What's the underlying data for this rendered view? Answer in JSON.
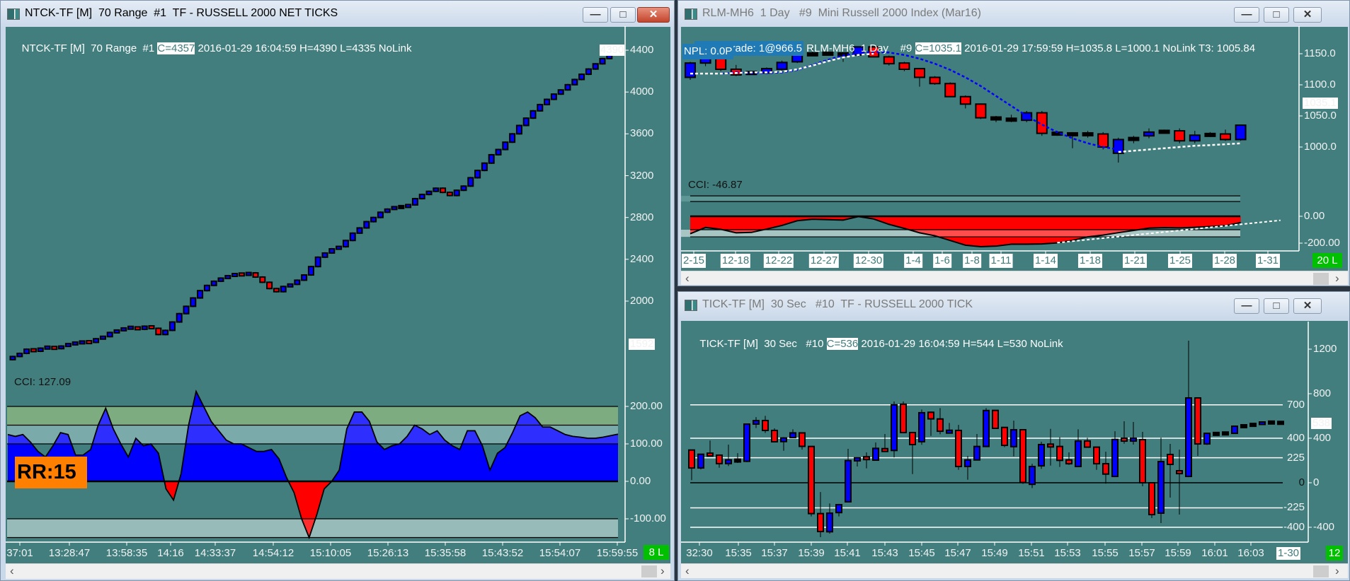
{
  "left": {
    "title": "NTCK-TF [M]  70 Range  #1  TF - RUSSELL 2000 NET TICKS",
    "header_prefix": "NTCK-TF [M]  70 Range  #1 ",
    "header_close": "C=4357",
    "header_rest": " 2016-01-29 16:04:59 H=4390 L=4335 NoLink",
    "last_price_label": "4390",
    "level_label": "1592",
    "price_axis": [
      {
        "label": "4400",
        "value": 4400
      },
      {
        "label": "4000",
        "value": 4000
      },
      {
        "label": "3600",
        "value": 3600
      },
      {
        "label": "3200",
        "value": 3200
      },
      {
        "label": "2800",
        "value": 2800
      },
      {
        "label": "2400",
        "value": 2400
      },
      {
        "label": "2000",
        "value": 2000
      }
    ],
    "cci_label": "CCI: 127.09",
    "cci_axis": [
      {
        "label": "200.00",
        "value": 200
      },
      {
        "label": "100.00",
        "value": 100
      },
      {
        "label": "0.00",
        "value": 0
      },
      {
        "label": "-100.00",
        "value": -100
      }
    ],
    "rr_label": "RR:15",
    "time_labels": [
      "37:01",
      "13:28:47",
      "13:58:35",
      "14:16",
      "14:33:37",
      "14:54:12",
      "15:10:05",
      "15:26:13",
      "15:35:58",
      "15:43:52",
      "15:54:07",
      "15:59:55"
    ],
    "bars_label": "8 L"
  },
  "top_right": {
    "title": "RLM-MH6  1 Day   #9  Mini Russell 2000 Index (Mar16)",
    "sim_label": "[Sim]  Trade: 1@966.5",
    "header_prefix": " RLM-MH6  1 Day    #9 ",
    "header_close": "C=1035.1",
    "header_rest": " 2016-01-29 17:59:59 H=1035.8 L=1000.1 NoLink T3: 1005.84",
    "npl_label": "NPL: 0.0P",
    "price_axis": [
      {
        "label": "1150.0",
        "value": 1150
      },
      {
        "label": "1100.0",
        "value": 1100
      },
      {
        "label": "1050.0",
        "value": 1050
      },
      {
        "label": "1000.0",
        "value": 1000
      }
    ],
    "last_price_label": "1035.1",
    "cci_label": "CCI: -46.87",
    "cci_axis": [
      {
        "label": "0.00",
        "value": 0
      },
      {
        "label": "-200.00",
        "value": -200
      }
    ],
    "time_labels": [
      "2-15",
      "12-18",
      "12-22",
      "12-27",
      "12-30",
      "1-4",
      "1-6",
      "1-8",
      "1-11",
      "1-14",
      "1-18",
      "1-21",
      "1-25",
      "1-28",
      "1-31"
    ],
    "bars_label": "20 L"
  },
  "bottom_right": {
    "title": "TICK-TF [M]  30 Sec   #10  TF - RUSSELL 2000 TICK",
    "header_prefix": "TICK-TF [M]  30 Sec   #10 ",
    "header_close": "C=536",
    "header_rest": " 2016-01-29 16:04:59 H=544 L=530 NoLink",
    "price_axis": [
      {
        "label": "1200",
        "value": 1200
      },
      {
        "label": "800",
        "value": 800
      },
      {
        "label": "400",
        "value": 400
      },
      {
        "label": "0",
        "value": 0
      },
      {
        "label": "-400",
        "value": -400
      }
    ],
    "level_lines": [
      {
        "label": "700",
        "value": 700
      },
      {
        "label": "400",
        "value": 400
      },
      {
        "label": "225",
        "value": 225
      },
      {
        "label": "0",
        "value": 0
      },
      {
        "label": "-225",
        "value": -225
      },
      {
        "label": "-400",
        "value": -400
      }
    ],
    "last_price_label": "538",
    "time_labels": [
      "32:30",
      "15:35",
      "15:37",
      "15:39",
      "15:41",
      "15:43",
      "15:45",
      "15:47",
      "15:49",
      "15:51",
      "15:53",
      "15:55",
      "15:57",
      "15:59",
      "16:01",
      "16:03"
    ],
    "date_label": "1-30",
    "bars_label": "12"
  },
  "colors": {
    "chart_bg": "#427e7e",
    "up": "#0000ff",
    "down": "#ff0000",
    "cci_pos": "#0000ff",
    "cci_neg": "#ff0000",
    "bars_badge": "#00c000",
    "rr_badge": "#ff8000"
  },
  "chart_data": [
    {
      "type": "candlestick",
      "title": "NTCK-TF [M] 70 Range",
      "ylim": [
        1400,
        4450
      ],
      "closes": [
        1470,
        1500,
        1540,
        1520,
        1550,
        1560,
        1545,
        1570,
        1590,
        1600,
        1610,
        1605,
        1640,
        1660,
        1700,
        1720,
        1740,
        1750,
        1730,
        1760,
        1740,
        1680,
        1720,
        1800,
        1880,
        1950,
        2030,
        2100,
        2150,
        2190,
        2220,
        2240,
        2260,
        2250,
        2270,
        2230,
        2180,
        2120,
        2090,
        2140,
        2160,
        2200,
        2250,
        2330,
        2420,
        2460,
        2500,
        2520,
        2580,
        2650,
        2700,
        2760,
        2800,
        2850,
        2880,
        2900,
        2900,
        2920,
        2980,
        3020,
        3050,
        3080,
        3040,
        3010,
        3060,
        3100,
        3180,
        3250,
        3320,
        3400,
        3450,
        3520,
        3600,
        3680,
        3750,
        3820,
        3880,
        3930,
        3980,
        4020,
        4070,
        4120,
        4170,
        4220,
        4270,
        4320,
        4357
      ],
      "cci": {
        "ylim": [
          -150,
          250
        ],
        "bands": [
          [
            150,
            200
          ],
          [
            100,
            150
          ],
          [
            -150,
            -100
          ]
        ],
        "values": [
          125,
          120,
          125,
          105,
          80,
          65,
          95,
          130,
          125,
          70,
          70,
          85,
          150,
          195,
          140,
          100,
          65,
          115,
          95,
          100,
          75,
          -20,
          -50,
          20,
          150,
          240,
          200,
          160,
          135,
          110,
          100,
          100,
          90,
          80,
          80,
          85,
          60,
          10,
          -30,
          -100,
          -150,
          -90,
          -20,
          0,
          30,
          140,
          185,
          185,
          160,
          105,
          85,
          95,
          100,
          120,
          150,
          140,
          125,
          135,
          110,
          95,
          85,
          135,
          135,
          95,
          30,
          75,
          90,
          130,
          175,
          185,
          170,
          145,
          145,
          135,
          125,
          120,
          118,
          115,
          115,
          118,
          122,
          126
        ]
      }
    },
    {
      "type": "candlestick",
      "title": "RLM-MH6 1 Day",
      "ohlc": [
        [
          1112,
          1137,
          1108,
          1135
        ],
        [
          1135,
          1150,
          1130,
          1147
        ],
        [
          1143,
          1145,
          1122,
          1125
        ],
        [
          1125,
          1132,
          1114,
          1116
        ],
        [
          1119,
          1121,
          1117,
          1119
        ],
        [
          1119,
          1128,
          1117,
          1126
        ],
        [
          1125,
          1139,
          1122,
          1136
        ],
        [
          1137,
          1152,
          1135,
          1149
        ],
        [
          1149,
          1158,
          1148,
          1149
        ],
        [
          1150,
          1151,
          1149,
          1150
        ],
        [
          1149,
          1150,
          1137,
          1149
        ],
        [
          1148,
          1162,
          1146,
          1161
        ],
        [
          1161,
          1162,
          1144,
          1145
        ],
        [
          1145,
          1147,
          1131,
          1134
        ],
        [
          1135,
          1137,
          1122,
          1125
        ],
        [
          1126,
          1127,
          1097,
          1112
        ],
        [
          1112,
          1114,
          1100,
          1102
        ],
        [
          1102,
          1104,
          1080,
          1081
        ],
        [
          1081,
          1083,
          1062,
          1069
        ],
        [
          1069,
          1070,
          1045,
          1047
        ],
        [
          1047,
          1050,
          1040,
          1045
        ],
        [
          1045,
          1052,
          1040,
          1043
        ],
        [
          1043,
          1058,
          1040,
          1055
        ],
        [
          1055,
          1058,
          1018,
          1022
        ],
        [
          1022,
          1026,
          1018,
          1021
        ],
        [
          1021,
          1024,
          998,
          1020
        ],
        [
          1020,
          1026,
          1015,
          1021
        ],
        [
          1021,
          1024,
          996,
          1000
        ],
        [
          990,
          1015,
          975,
          1012
        ],
        [
          1012,
          1018,
          1006,
          1014
        ],
        [
          1018,
          1030,
          1014,
          1024
        ],
        [
          1024,
          1028,
          1022,
          1025
        ],
        [
          1026,
          1030,
          1006,
          1010
        ],
        [
          1010,
          1026,
          1006,
          1019
        ],
        [
          1019,
          1024,
          1016,
          1020
        ],
        [
          1021,
          1028,
          1010,
          1012
        ],
        [
          1012,
          1036,
          1010,
          1035.1
        ]
      ],
      "ma_blue": [
        null,
        null,
        1118,
        1120,
        1119,
        1119,
        1120,
        1124,
        1132,
        1140,
        1147,
        1151,
        1153,
        1152,
        1148,
        1142,
        1134,
        1124,
        1112,
        1098,
        1082,
        1066,
        1050,
        1036,
        1024,
        1014,
        1006,
        1000,
        996,
        null,
        null,
        null,
        null,
        null,
        null,
        null,
        null
      ],
      "ma_white": [
        1118,
        1118,
        1118,
        1119,
        1120,
        1120,
        1121,
        1125,
        1131,
        1138,
        1144,
        1148,
        1150,
        null,
        null,
        null,
        null,
        null,
        null,
        null,
        null,
        null,
        null,
        null,
        null,
        null,
        null,
        null,
        992,
        994,
        996,
        998,
        1000,
        1002,
        1003,
        1004.5,
        1005.84
      ],
      "cci": {
        "ylim": [
          -230,
          170
        ],
        "lines": [
          152,
          110,
          0,
          -100,
          -153
        ],
        "values": [
          -130,
          -83,
          -97,
          -123,
          -120,
          -95,
          -68,
          -33,
          -22,
          -25,
          -28,
          -2,
          -20,
          -60,
          -90,
          -123,
          -145,
          -180,
          -215,
          -226,
          -222,
          -208,
          -208,
          -206,
          -198,
          -180,
          -153,
          -140,
          -122,
          -105,
          -88,
          -84,
          -86,
          -82,
          -76,
          -70,
          -46.87
        ],
        "trend": [
          [
            24,
            -197
          ],
          [
            38.6,
            -30
          ]
        ]
      }
    },
    {
      "type": "candlestick",
      "title": "TICK-TF [M] 30 Sec",
      "ylim": [
        -500,
        1350
      ],
      "ohlc": [
        [
          294,
          294,
          23,
          133
        ],
        [
          133,
          260,
          120,
          256
        ],
        [
          256,
          379,
          240,
          250
        ],
        [
          248,
          255,
          135,
          172
        ],
        [
          172,
          343,
          150,
          206
        ],
        [
          200,
          266,
          178,
          199
        ],
        [
          193,
          530,
          185,
          527
        ],
        [
          527,
          590,
          491,
          558
        ],
        [
          559,
          601,
          448,
          470
        ],
        [
          470,
          489,
          365,
          368
        ],
        [
          370,
          410,
          287,
          402
        ],
        [
          406,
          480,
          400,
          448
        ],
        [
          448,
          452,
          298,
          327
        ],
        [
          326,
          330,
          -302,
          -277
        ],
        [
          -277,
          -83,
          -489,
          -438
        ],
        [
          -440,
          -186,
          -457,
          -273
        ],
        [
          -268,
          -190,
          -302,
          -197
        ],
        [
          -171,
          305,
          -175,
          199
        ],
        [
          197,
          230,
          146,
          224
        ],
        [
          224,
          273,
          129,
          218
        ],
        [
          203,
          362,
          200,
          309
        ],
        [
          296,
          438,
          290,
          292
        ],
        [
          290,
          730,
          227,
          700
        ],
        [
          706,
          730,
          445,
          451
        ],
        [
          451,
          455,
          78,
          343
        ],
        [
          369,
          658,
          341,
          629
        ],
        [
          633,
          640,
          421,
          574
        ],
        [
          573,
          671,
          436,
          463
        ],
        [
          453,
          537,
          442,
          465
        ],
        [
          470,
          520,
          116,
          146
        ],
        [
          146,
          241,
          27,
          205
        ],
        [
          205,
          438,
          200,
          326
        ],
        [
          326,
          671,
          320,
          649
        ],
        [
          650,
          655,
          486,
          489
        ],
        [
          497,
          500,
          320,
          336
        ],
        [
          324,
          558,
          237,
          476
        ],
        [
          476,
          480,
          -10,
          3
        ],
        [
          -14,
          171,
          -48,
          146
        ],
        [
          152,
          368,
          125,
          343
        ],
        [
          343,
          484,
          154,
          326
        ],
        [
          326,
          410,
          142,
          201
        ],
        [
          205,
          273,
          160,
          171
        ],
        [
          146,
          480,
          140,
          375
        ],
        [
          375,
          404,
          315,
          320
        ],
        [
          320,
          325,
          116,
          171
        ],
        [
          171,
          279,
          -8,
          78
        ],
        [
          57,
          463,
          50,
          389
        ],
        [
          389,
          552,
          351,
          385
        ],
        [
          385,
          546,
          343,
          389
        ],
        [
          387,
          457,
          -32,
          0
        ],
        [
          0,
          5,
          -317,
          -286
        ],
        [
          -273,
          406,
          -362,
          190
        ],
        [
          254,
          349,
          -133,
          165
        ],
        [
          100,
          298,
          -286,
          90
        ],
        [
          57,
          1276,
          50,
          762
        ],
        [
          762,
          765,
          241,
          349
        ],
        [
          349,
          450,
          340,
          444
        ],
        [
          440,
          444,
          436,
          438
        ],
        [
          442,
          446,
          440,
          444
        ],
        [
          444,
          512,
          440,
          508
        ],
        [
          508,
          510,
          506,
          508
        ],
        [
          520,
          522,
          518,
          520
        ],
        [
          524,
          548,
          522,
          546
        ],
        [
          541,
          543,
          539,
          541
        ],
        [
          538,
          540,
          536,
          538
        ]
      ]
    }
  ]
}
